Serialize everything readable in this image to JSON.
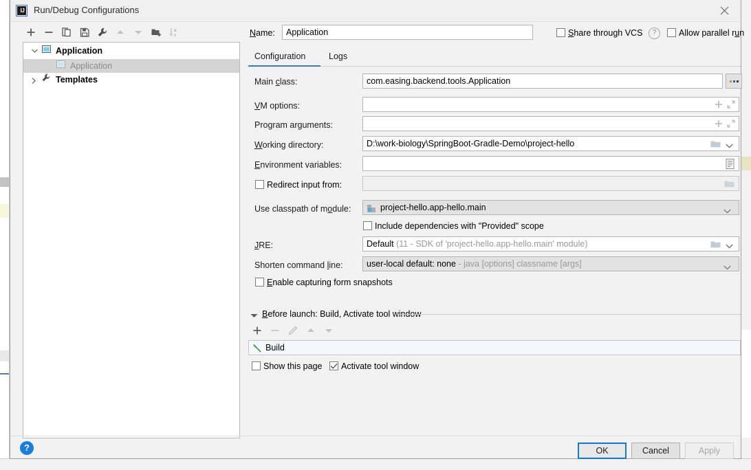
{
  "window": {
    "title": "Run/Debug Configurations",
    "app_icon": "intellij-idea-icon",
    "close_icon": "close-icon"
  },
  "left_toolbar": {
    "buttons": [
      {
        "name": "add-configuration-button",
        "icon": "plus-icon",
        "enabled": true
      },
      {
        "name": "remove-configuration-button",
        "icon": "minus-icon",
        "enabled": true
      },
      {
        "name": "copy-configuration-button",
        "icon": "copy-icon",
        "enabled": true
      },
      {
        "name": "save-configuration-button",
        "icon": "save-icon",
        "enabled": true
      },
      {
        "name": "edit-templates-button",
        "icon": "wrench-icon",
        "enabled": true
      },
      {
        "name": "move-up-button",
        "icon": "arrow-up-icon",
        "enabled": false
      },
      {
        "name": "move-down-button",
        "icon": "arrow-down-icon",
        "enabled": false
      },
      {
        "name": "create-folder-button",
        "icon": "folder-add-icon",
        "enabled": true
      },
      {
        "name": "sort-configurations-button",
        "icon": "sort-az-icon",
        "enabled": false
      }
    ]
  },
  "tree": {
    "items": [
      {
        "label": "Application",
        "icon": "application-run-icon",
        "bold": true,
        "expanded": true,
        "selected": false,
        "depth": 0,
        "has_arrow": true
      },
      {
        "label": "Application",
        "icon": "application-run-icon",
        "bold": false,
        "expanded": false,
        "selected": true,
        "depth": 1,
        "has_arrow": false
      },
      {
        "label": "Templates",
        "icon": "wrench-icon",
        "bold": true,
        "expanded": false,
        "selected": false,
        "depth": 0,
        "has_arrow": true
      }
    ]
  },
  "header": {
    "name_label": "Name:",
    "name_value": "Application",
    "name_placeholder": "",
    "share_vcs_label": "Share through VCS",
    "share_vcs_checked": false,
    "help_icon": "question-mark-icon",
    "allow_parallel_label": "Allow parallel run",
    "allow_parallel_checked": false
  },
  "tabs": {
    "items": [
      {
        "label": "Configuration",
        "active": true
      },
      {
        "label": "Logs",
        "active": false
      }
    ],
    "accent_color": "#3d7ab8"
  },
  "form": {
    "main_class": {
      "label": "Main class:",
      "value": "com.easing.backend.tools.Application",
      "browse_icon": "ellipsis-icon"
    },
    "vm_options": {
      "label": "VM options:",
      "value": "",
      "icons": [
        "plus-icon",
        "expand-icon"
      ]
    },
    "program_arguments": {
      "label": "Program arguments:",
      "value": "",
      "icons": [
        "plus-icon",
        "expand-icon"
      ]
    },
    "working_directory": {
      "label": "Working directory:",
      "value": "D:\\work-biology\\SpringBoot-Gradle-Demo\\project-hello",
      "icons": [
        "folder-icon",
        "chevron-down-icon"
      ]
    },
    "environment_variables": {
      "label": "Environment variables:",
      "value": "",
      "icons": [
        "list-icon"
      ]
    },
    "redirect_input": {
      "label": "Redirect input from:",
      "checked": false,
      "value": "",
      "disabled": true,
      "icons": [
        "folder-icon"
      ]
    },
    "classpath_module": {
      "label": "Use classpath of module:",
      "value": "project-hello.app-hello.main",
      "module_icon": "module-icon",
      "icons": [
        "chevron-down-icon"
      ]
    },
    "include_provided": {
      "label": "Include dependencies with \"Provided\" scope",
      "checked": false
    },
    "jre": {
      "label": "JRE:",
      "value": "Default",
      "value_detail": "(11 - SDK of 'project-hello.app-hello.main' module)",
      "icons": [
        "folder-icon",
        "chevron-down-icon"
      ]
    },
    "shorten_command_line": {
      "label": "Shorten command line:",
      "value": "user-local default: none",
      "value_detail": "- java [options] classname [args]",
      "icons": [
        "chevron-down-icon"
      ]
    },
    "capture_snapshots": {
      "label": "Enable capturing form snapshots",
      "checked": false
    }
  },
  "before_launch": {
    "title": "Before launch: Build, Activate tool window",
    "collapse_icon": "chevron-down-icon",
    "toolbar": [
      {
        "name": "add-task-button",
        "icon": "plus-icon",
        "enabled": true
      },
      {
        "name": "remove-task-button",
        "icon": "minus-icon",
        "enabled": false
      },
      {
        "name": "edit-task-button",
        "icon": "pencil-icon",
        "enabled": false
      },
      {
        "name": "task-move-up-button",
        "icon": "arrow-up-icon",
        "enabled": false
      },
      {
        "name": "task-move-down-button",
        "icon": "arrow-down-icon",
        "enabled": false
      }
    ],
    "tasks": [
      {
        "label": "Build",
        "icon": "hammer-icon",
        "icon_color": "#4a9a52"
      }
    ],
    "show_this_page": {
      "label": "Show this page",
      "checked": false
    },
    "activate_tool_window": {
      "label": "Activate tool window",
      "checked": true
    }
  },
  "footer": {
    "help_icon": "help-circle-icon",
    "help_label": "?",
    "ok_label": "OK",
    "cancel_label": "Cancel",
    "apply_label": "Apply",
    "apply_enabled": false
  }
}
